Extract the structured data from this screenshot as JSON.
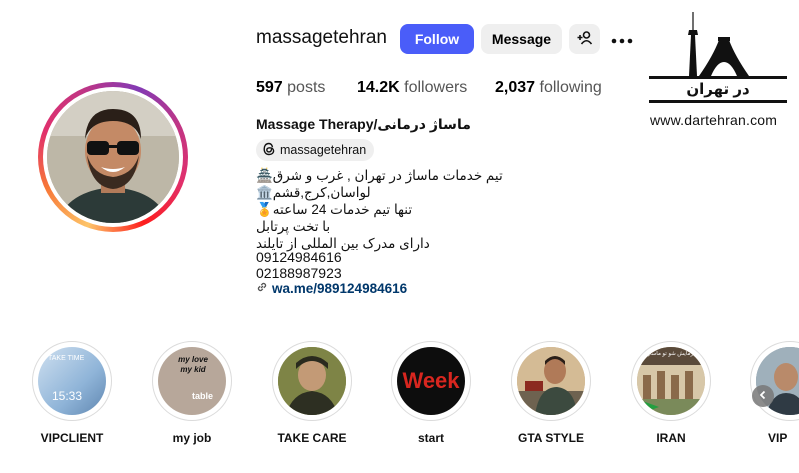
{
  "profile": {
    "username": "massagetehran",
    "follow_label": "Follow",
    "message_label": "Message",
    "stats": {
      "posts_count": "597",
      "posts_label": "posts",
      "followers_count": "14.2K",
      "followers_label": "followers",
      "following_count": "2,037",
      "following_label": "following"
    },
    "name": "Massage Therapy/ماساژ درمانی",
    "threads_handle": "massagetehran",
    "bio_lines": [
      "تیم خدمات ماساژ در تهران , غرب و شرق🏯",
      "لواسان,کرج,قشم🏛️",
      "تنها تیم خدمات 24 ساعته🏅",
      "با تخت پرتابل",
      "دارای مدرک بین المللی از تایلند"
    ],
    "phones": [
      "09124984616",
      "02188987923"
    ],
    "link": "wa.me/989124984616"
  },
  "logo": {
    "brand_text": "در تهران",
    "url": "www.dartehran.com"
  },
  "highlights": [
    {
      "label": "VIPCLIENT",
      "img_text": "15:33",
      "img_small": "TAKE TIME"
    },
    {
      "label": "my job",
      "img_text": "my love my kid",
      "img_small": "table"
    },
    {
      "label": "TAKE CARE"
    },
    {
      "label": "start",
      "img_text": "Week"
    },
    {
      "label": "GTA STYLE"
    },
    {
      "label": "IRAN",
      "img_small": "آزمایش شو تو ماساژ"
    },
    {
      "label": "VIP"
    }
  ],
  "colors": {
    "follow_button": "#4a5df9",
    "secondary_button": "#efefef",
    "link": "#00376b"
  }
}
